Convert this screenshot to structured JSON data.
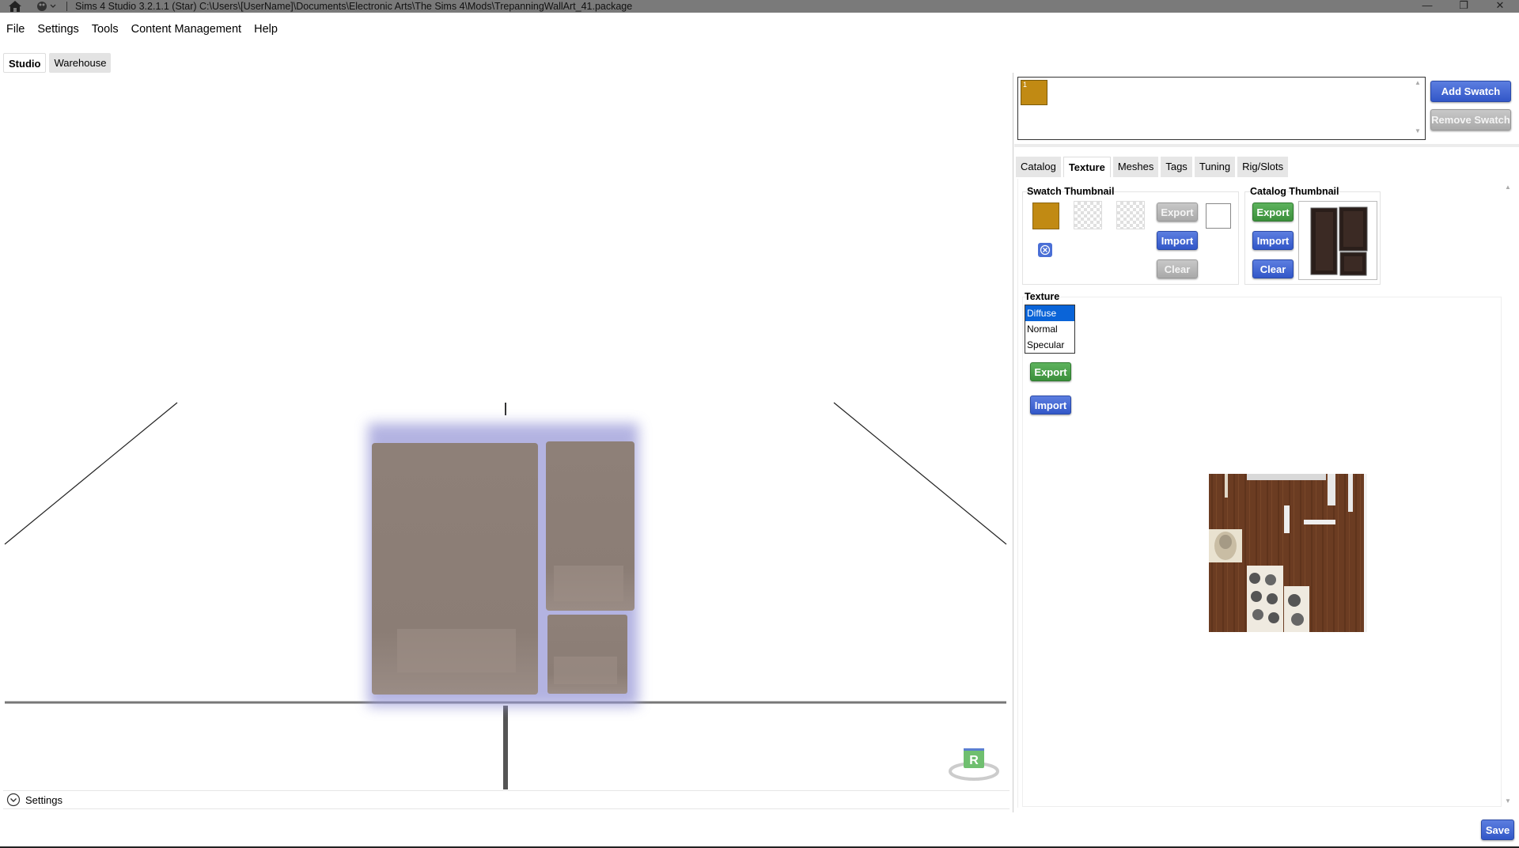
{
  "window": {
    "title": "Sims 4 Studio 3.2.1.1 (Star)  C:\\Users\\[UserName]\\Documents\\Electronic Arts\\The Sims 4\\Mods\\TrepanningWallArt_41.package",
    "minimize": "—",
    "restore": "❐",
    "close": "✕"
  },
  "menu": [
    "File",
    "Settings",
    "Tools",
    "Content Management",
    "Help"
  ],
  "main_tabs": {
    "studio": "Studio",
    "warehouse": "Warehouse"
  },
  "viewport": {
    "settings_label": "Settings",
    "reset_badge": "R"
  },
  "swatches": {
    "items": [
      {
        "label": "1",
        "color": "#c18a13"
      }
    ],
    "add_label": "Add Swatch",
    "remove_label": "Remove Swatch"
  },
  "sub_tabs": [
    "Catalog",
    "Texture",
    "Meshes",
    "Tags",
    "Tuning",
    "Rig/Slots"
  ],
  "swatch_thumbnail": {
    "title": "Swatch Thumbnail",
    "color": "#c18a13",
    "export_label": "Export",
    "import_label": "Import",
    "clear_label": "Clear"
  },
  "catalog_thumbnail": {
    "title": "Catalog Thumbnail",
    "export_label": "Export",
    "import_label": "Import",
    "clear_label": "Clear"
  },
  "texture": {
    "title": "Texture",
    "options": [
      "Diffuse",
      "Normal",
      "Specular"
    ],
    "selected": "Diffuse",
    "export_label": "Export",
    "import_label": "Import"
  },
  "footer": {
    "save_label": "Save"
  },
  "colors": {
    "accent_blue": "#3a5fcd",
    "accent_green": "#4a9f4a",
    "swatch": "#c18a13",
    "selection": "#0a64d8"
  }
}
